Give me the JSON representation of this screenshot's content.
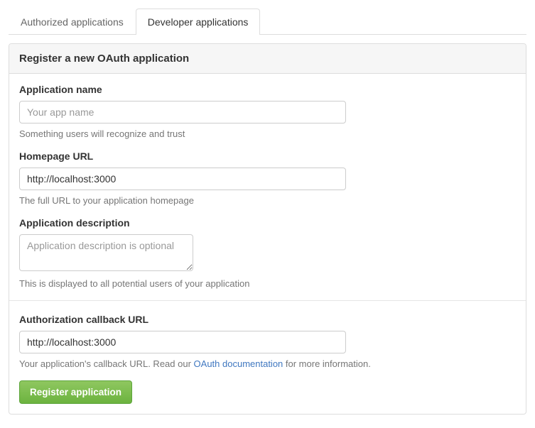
{
  "tabs": {
    "authorized": "Authorized applications",
    "developer": "Developer applications"
  },
  "panel": {
    "title": "Register a new OAuth application"
  },
  "fields": {
    "app_name": {
      "label": "Application name",
      "placeholder": "Your app name",
      "value": "",
      "hint": "Something users will recognize and trust"
    },
    "homepage": {
      "label": "Homepage URL",
      "value": "http://localhost:3000",
      "hint": "The full URL to your application homepage"
    },
    "description": {
      "label": "Application description",
      "placeholder": "Application description is optional",
      "value": "",
      "hint": "This is displayed to all potential users of your application"
    },
    "callback": {
      "label": "Authorization callback URL",
      "value": "http://localhost:3000",
      "hint_pre": "Your application's callback URL. Read our ",
      "hint_link": "OAuth documentation",
      "hint_post": " for more information."
    }
  },
  "submit_label": "Register application"
}
